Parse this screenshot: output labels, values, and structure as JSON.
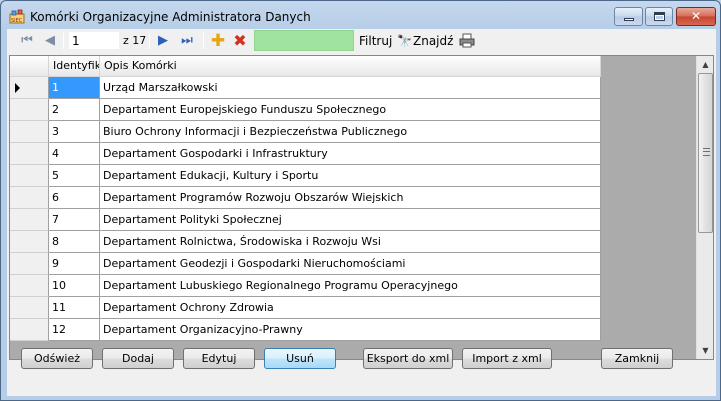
{
  "window": {
    "title": "Komórki Organizacyjne Administratora Danych",
    "controls": {
      "minimize": "minimize-icon",
      "maximize": "maximize-icon",
      "close": "close-icon"
    }
  },
  "toolbar": {
    "position_value": "1",
    "count_label": "z 17",
    "filter_label": "Filtruj",
    "find_label": "Znajdź",
    "filter_color": "#9fe39f",
    "icons": [
      "first-record-icon",
      "previous-record-icon",
      "next-record-icon",
      "last-record-icon",
      "add-icon",
      "delete-icon",
      "binoculars-icon",
      "printer-icon"
    ]
  },
  "grid": {
    "columns": [
      "Identyfikator",
      "Opis Komórki"
    ],
    "rows": [
      {
        "id": "1",
        "desc": "Urząd Marszałkowski",
        "selected": true
      },
      {
        "id": "2",
        "desc": "Departament Europejskiego Funduszu Społecznego"
      },
      {
        "id": "3",
        "desc": "Biuro Ochrony Informacji i Bezpieczeństwa Publicznego"
      },
      {
        "id": "4",
        "desc": "Departament Gospodarki i Infrastruktury"
      },
      {
        "id": "5",
        "desc": "Departament Edukacji, Kultury i Sportu"
      },
      {
        "id": "6",
        "desc": "Departament Programów Rozwoju Obszarów Wiejskich"
      },
      {
        "id": "7",
        "desc": "Departament Polityki Społecznej"
      },
      {
        "id": "8",
        "desc": "Departament Rolnictwa, Środowiska i Rozwoju Wsi"
      },
      {
        "id": "9",
        "desc": "Departament Geodezji i Gospodarki Nieruchomościami"
      },
      {
        "id": "10",
        "desc": "Departament Lubuskiego Regionalnego Programu Operacyjnego"
      },
      {
        "id": "11",
        "desc": "Departament Ochrony Zdrowia"
      },
      {
        "id": "12",
        "desc": "Departament Organizacyjno-Prawny"
      }
    ]
  },
  "buttons": {
    "refresh": "Odśwież",
    "add": "Dodaj",
    "edit": "Edytuj",
    "delete": "Usuń",
    "export": "Eksport do xml",
    "import": "Import z xml",
    "close": "Zamknij"
  }
}
